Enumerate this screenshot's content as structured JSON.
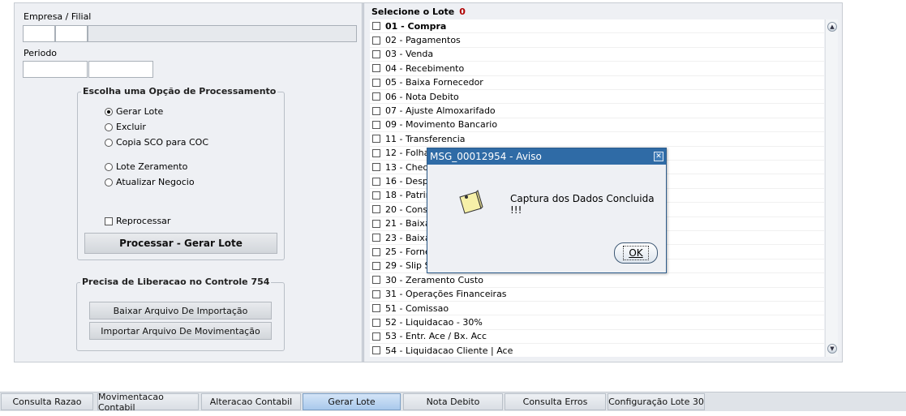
{
  "form": {
    "empresa_label": "Empresa / Filial",
    "periodo_label": "Periodo"
  },
  "processing": {
    "title": "Escolha uma Opção de Processamento",
    "options": [
      "Gerar Lote",
      "Excluir",
      "Copia SCO para COC",
      "Lote Zeramento",
      "Atualizar Negocio"
    ],
    "selected": "Gerar Lote",
    "reprocessar_label": "Reprocessar",
    "process_button": "Processar - Gerar Lote"
  },
  "liberacao": {
    "title": "Precisa de Liberacao no Controle 754",
    "download_button": "Baixar Arquivo De Importação",
    "import_button": "Importar Arquivo De Movimentação"
  },
  "lote": {
    "title": "Selecione o Lote",
    "count": "0",
    "items": [
      "01 - Compra",
      "02 - Pagamentos",
      "03 - Venda",
      "04 - Recebimento",
      "05 - Baixa Fornecedor",
      "06 - Nota Debito",
      "07 - Ajuste Almoxarifado",
      "09 - Movimento Bancario",
      "11 - Transferencia",
      "12 - Folha",
      "13 - Cheq",
      "16 - Desp",
      "18 - Patrim",
      "20 - Consu",
      "21 - Baixa",
      "23 - Baixa",
      "25 - Forne",
      "29 - Slip S",
      "30 - Zeramento Custo",
      "31 - Operações Financeiras",
      "51 - Comissao",
      "52 - Liquidacao - 30%",
      "53 - Entr. Ace / Bx. Acc",
      "54 - Liquidacao Cliente | Ace"
    ]
  },
  "dialog": {
    "title": "MSG_00012954 - Aviso",
    "message": "Captura dos Dados Concluida !!!",
    "ok_label": "OK",
    "icon": "note-icon"
  },
  "tabs": [
    "Consulta Razao",
    "Movimentacao Contabil",
    "Alteracao Contabil",
    "Gerar Lote",
    "Nota Debito",
    "Consulta Erros",
    "Configuração Lote 30"
  ],
  "active_tab": "Gerar Lote"
}
